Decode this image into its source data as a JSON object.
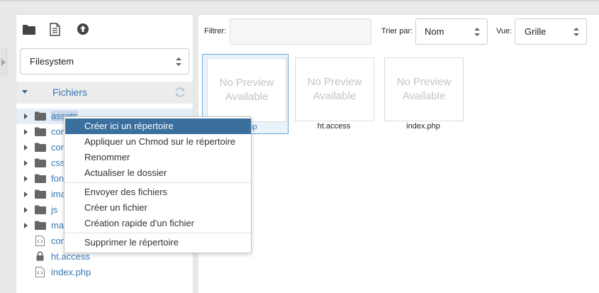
{
  "toolbar": {
    "icons": [
      "folder-icon",
      "document-icon",
      "upload-icon"
    ]
  },
  "sidebar": {
    "filesystem_select": "Filesystem",
    "tree_title": "Fichiers",
    "items": [
      {
        "label": "assets",
        "type": "folder"
      },
      {
        "label": "cor",
        "type": "folder"
      },
      {
        "label": "cor",
        "type": "folder"
      },
      {
        "label": "css",
        "type": "folder"
      },
      {
        "label": "fon",
        "type": "folder"
      },
      {
        "label": "ima",
        "type": "folder"
      },
      {
        "label": "js",
        "type": "folder"
      },
      {
        "label": "ma",
        "type": "folder"
      },
      {
        "label": "cor",
        "type": "file-code"
      },
      {
        "label": "ht.access",
        "type": "file-lock"
      },
      {
        "label": "index.php",
        "type": "file-code"
      }
    ]
  },
  "main": {
    "filter_label": "Filtrer:",
    "filter_value": "",
    "sort_label": "Trier par:",
    "sort_value": "Nom",
    "view_label": "Vue:",
    "view_value": "Grille",
    "files": [
      {
        "name": "re.php",
        "preview_line1": "No Preview",
        "preview_line2": "Available",
        "selected": true
      },
      {
        "name": "ht.access",
        "preview_line1": "No Preview",
        "preview_line2": "Available",
        "selected": false
      },
      {
        "name": "index.php",
        "preview_line1": "No Preview",
        "preview_line2": "Available",
        "selected": false
      }
    ]
  },
  "context_menu": {
    "items": [
      "Créer ici un répertoire",
      "Appliquer un Chmod sur le répertoire",
      "Renommer",
      "Actualiser le dossier",
      "Envoyer des fichiers",
      "Créer un fichier",
      "Création rapide d'un fichier",
      "Supprimer le répertoire"
    ]
  },
  "colors": {
    "accent": "#3a78b5",
    "menu_active": "#3a6f9e"
  }
}
